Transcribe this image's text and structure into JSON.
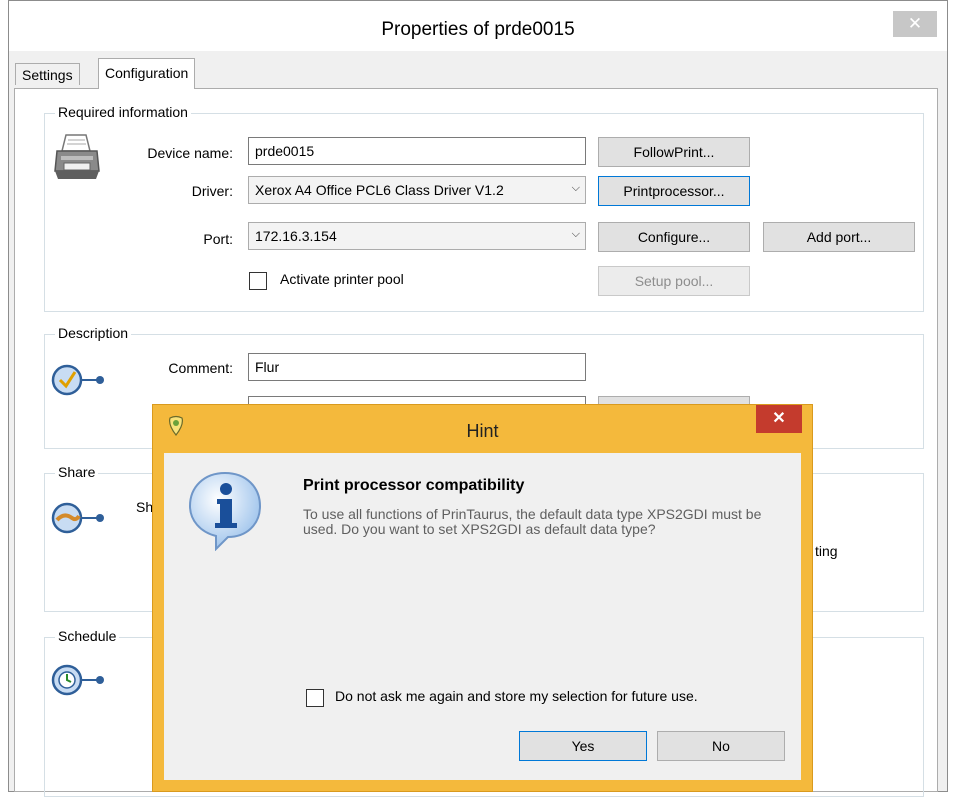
{
  "window": {
    "title": "Properties of prde0015",
    "close_glyph": "✕"
  },
  "tabs": [
    {
      "label": "Settings",
      "selected": false
    },
    {
      "label": "Configuration",
      "selected": true
    }
  ],
  "required": {
    "group_label": "Required information",
    "device_name_label": "Device name:",
    "device_name_value": "prde0015",
    "driver_label": "Driver:",
    "driver_value": "Xerox A4 Office PCL6 Class Driver V1.2",
    "port_label": "Port:",
    "port_value": "172.16.3.154",
    "printer_pool_label": "Activate printer pool",
    "printer_pool_checked": false,
    "followprint_button": "FollowPrint...",
    "printprocessor_button": "Printprocessor...",
    "configure_button": "Configure...",
    "add_port_button": "Add port...",
    "setup_pool_button": "Setup pool..."
  },
  "description": {
    "group_label": "Description",
    "comment_label": "Comment:",
    "comment_value": "Flur"
  },
  "share": {
    "group_label": "Share",
    "partial_text": "Sh",
    "partial_right_text": "ting"
  },
  "schedule": {
    "group_label": "Schedule"
  },
  "hint": {
    "title": "Hint",
    "close_glyph": "✕",
    "heading": "Print processor compatibility",
    "message": "To use all functions of PrinTaurus, the default data type XPS2GDI must be used. Do you want to set XPS2GDI as default data type?",
    "dont_ask_label": "Do not ask me again and store my selection for future use.",
    "dont_ask_checked": false,
    "yes_button": "Yes",
    "no_button": "No"
  },
  "colors": {
    "dialog_frame": "#f4b93c",
    "dialog_close": "#c43b2d",
    "focus_border": "#0078d7"
  }
}
